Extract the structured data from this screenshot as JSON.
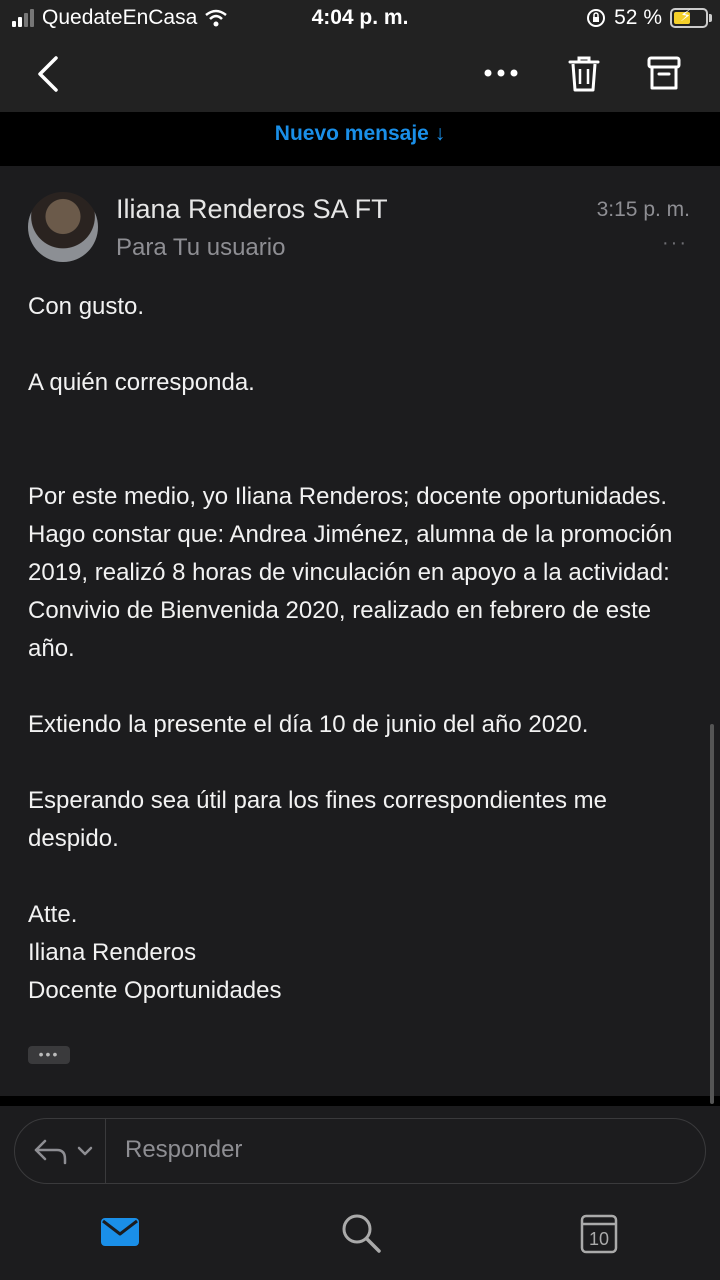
{
  "status_bar": {
    "carrier": "QuedateEnCasa",
    "time": "4:04 p. m.",
    "battery": "52 %"
  },
  "nav": {
    "icons": [
      "back-icon",
      "more-icon",
      "trash-icon",
      "archive-icon"
    ]
  },
  "banner": {
    "label": "Nuevo mensaje ↓"
  },
  "message": {
    "sender": "Iliana Renderos SA FT",
    "recipient": "Para Tu usuario",
    "time": "3:15 p. m.",
    "body": [
      "Con gusto.",
      "A quién corresponda.",
      "Por este medio, yo Iliana Renderos; docente oportunidades. Hago constar que: Andrea Jiménez, alumna de la promoción 2019, realizó 8 horas de vinculación en apoyo a la actividad: Convivio de Bienvenida 2020, realizado en febrero de este año.",
      "Extiendo la presente el día 10 de junio del año 2020.",
      "Esperando sea útil para los fines correspondientes me despido.",
      "Atte.",
      "Iliana Renderos",
      "Docente Oportunidades"
    ]
  },
  "reply": {
    "placeholder": "Responder"
  },
  "tabs": {
    "calendar_day": "10",
    "icons": [
      "mail-icon",
      "search-icon",
      "calendar-icon"
    ]
  },
  "colors": {
    "accent": "#1a8fe8"
  }
}
